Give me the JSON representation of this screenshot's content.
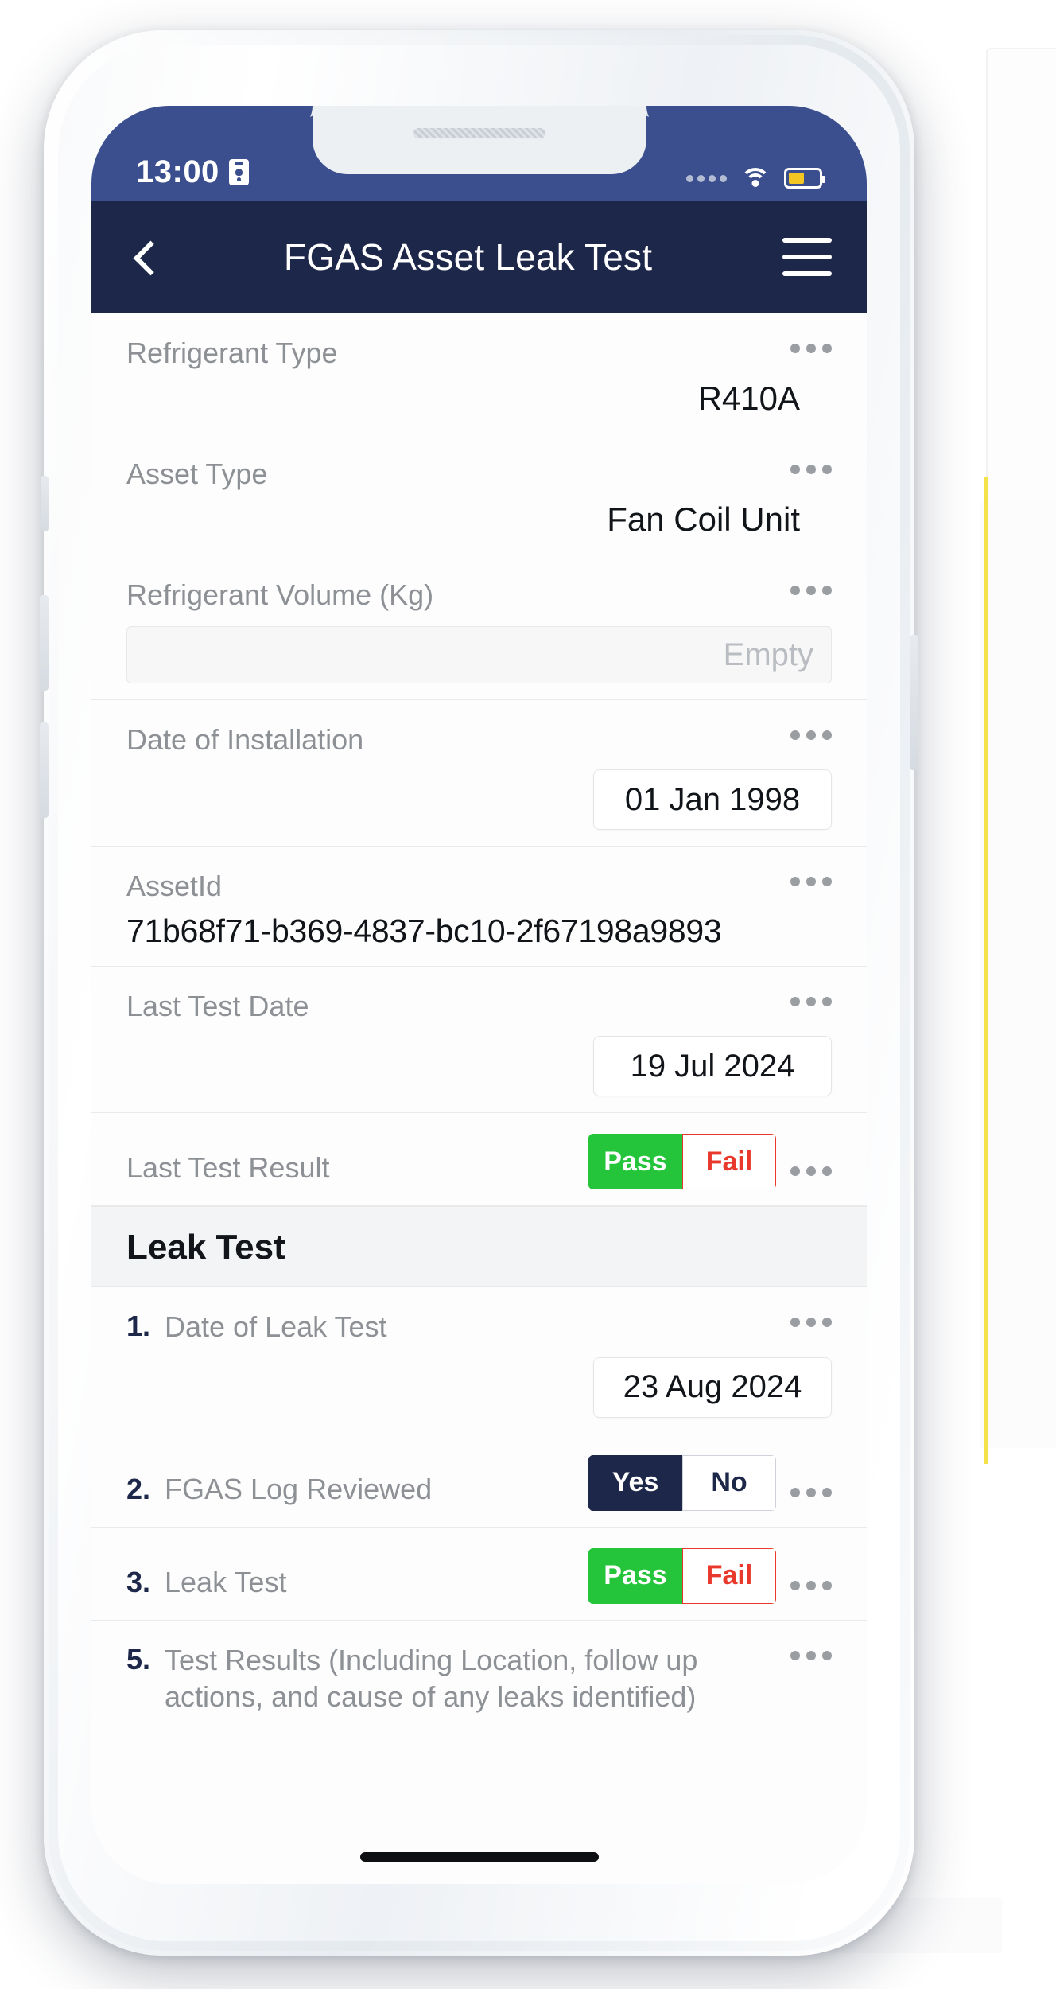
{
  "statusbar": {
    "time": "13:00",
    "badge_icon": "id-badge-icon",
    "wifi_icon": "wifi-icon",
    "battery_icon": "battery-icon",
    "signal_icon": "signal-dots-icon"
  },
  "appbar": {
    "back_icon": "back-chevron-icon",
    "title": "FGAS Asset Leak Test",
    "menu_icon": "hamburger-menu-icon"
  },
  "kebab_icon": "more-options-icon",
  "fields": [
    {
      "label": "Refrigerant Type",
      "value": "R410A",
      "kind": "value"
    },
    {
      "label": "Asset Type",
      "value": "Fan Coil Unit",
      "kind": "value"
    },
    {
      "label": "Refrigerant Volume (Kg)",
      "placeholder": "Empty",
      "kind": "input"
    },
    {
      "label": "Date of Installation",
      "value": "01 Jan 1998",
      "kind": "date"
    },
    {
      "label": "AssetId",
      "value": "71b68f71-b369-4837-bc10-2f67198a9893",
      "kind": "value-left"
    },
    {
      "label": "Last Test Date",
      "value": "19 Jul 2024",
      "kind": "date"
    },
    {
      "label": "Last Test Result",
      "kind": "segment",
      "options": [
        "Pass",
        "Fail"
      ],
      "selected": "Pass"
    }
  ],
  "section": {
    "title": "Leak Test"
  },
  "leak_items": [
    {
      "number": "1.",
      "label": "Date of Leak Test",
      "value": "23 Aug 2024",
      "kind": "date"
    },
    {
      "number": "2.",
      "label": "FGAS Log Reviewed",
      "kind": "segment",
      "options": [
        "Yes",
        "No"
      ],
      "selected": "Yes"
    },
    {
      "number": "3.",
      "label": "Leak Test",
      "kind": "segment",
      "options": [
        "Pass",
        "Fail"
      ],
      "selected": "Pass"
    },
    {
      "number": "5.",
      "label": "Test Results (Including Location, follow up actions, and cause of any leaks identified)",
      "kind": "label-only"
    }
  ],
  "colors": {
    "appbar": "#1d2749",
    "statusbar": "#3b4f8f",
    "pass_green": "#25c53b",
    "fail_red": "#e8392c",
    "navy": "#1d2749",
    "battery_yellow": "#f3c623"
  }
}
